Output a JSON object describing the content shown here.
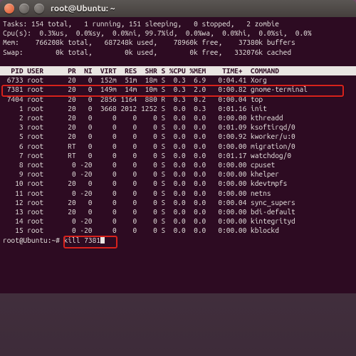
{
  "window": {
    "title": "root@Ubuntu: ~"
  },
  "summary": {
    "tasks": "Tasks: 154 total,   1 running, 151 sleeping,   0 stopped,   2 zombie",
    "cpu": "Cpu(s):  0.3%us,  0.0%sy,  0.0%ni, 99.7%id,  0.0%wa,  0.0%hi,  0.0%si,  0.0%",
    "mem": "Mem:    766208k total,   687248k used,    78960k free,    37380k buffers",
    "swap": "Swap:        0k total,        0k used,        0k free,   332076k cached"
  },
  "header": "  PID USER      PR  NI  VIRT  RES  SHR S %CPU %MEM    TIME+  COMMAND        ",
  "rows": [
    " 6733 root      20   0  152m  51m  18m S  0.3  6.9   0:04.41 Xorg",
    " 7381 root      20   0  149m  14m  10m S  0.3  2.0   0:00.82 gnome-terminal",
    " 7404 root      20   0  2856 1164  880 R  0.3  0.2   0:00.04 top",
    "    1 root      20   0  3668 2012 1252 S  0.0  0.3   0:01.16 init",
    "    2 root      20   0     0    0    0 S  0.0  0.0   0:00.00 kthreadd",
    "    3 root      20   0     0    0    0 S  0.0  0.0   0:01.09 ksoftirqd/0",
    "    5 root      20   0     0    0    0 S  0.0  0.0   0:00.92 kworker/u:0",
    "    6 root      RT   0     0    0    0 S  0.0  0.0   0:00.00 migration/0",
    "    7 root      RT   0     0    0    0 S  0.0  0.0   0:01.17 watchdog/0",
    "    8 root       0 -20     0    0    0 S  0.0  0.0   0:00.00 cpuset",
    "    9 root       0 -20     0    0    0 S  0.0  0.0   0:00.00 khelper",
    "   10 root      20   0     0    0    0 S  0.0  0.0   0:00.00 kdevtmpfs",
    "   11 root       0 -20     0    0    0 S  0.0  0.0   0:00.00 netns",
    "   12 root      20   0     0    0    0 S  0.0  0.0   0:00.04 sync_supers",
    "   13 root      20   0     0    0    0 S  0.0  0.0   0:00.00 bdi-default",
    "   14 root       0 -20     0    0    0 S  0.0  0.0   0:00.00 kintegrityd",
    "   15 root       0 -20     0    0    0 S  0.0  0.0   0:00.00 kblockd"
  ],
  "prompt": {
    "user_host": "root@Ubuntu",
    "path": "~",
    "sep1": ":",
    "sep2": "#",
    "command": "kill 7381"
  },
  "highlight_row_index": 1
}
